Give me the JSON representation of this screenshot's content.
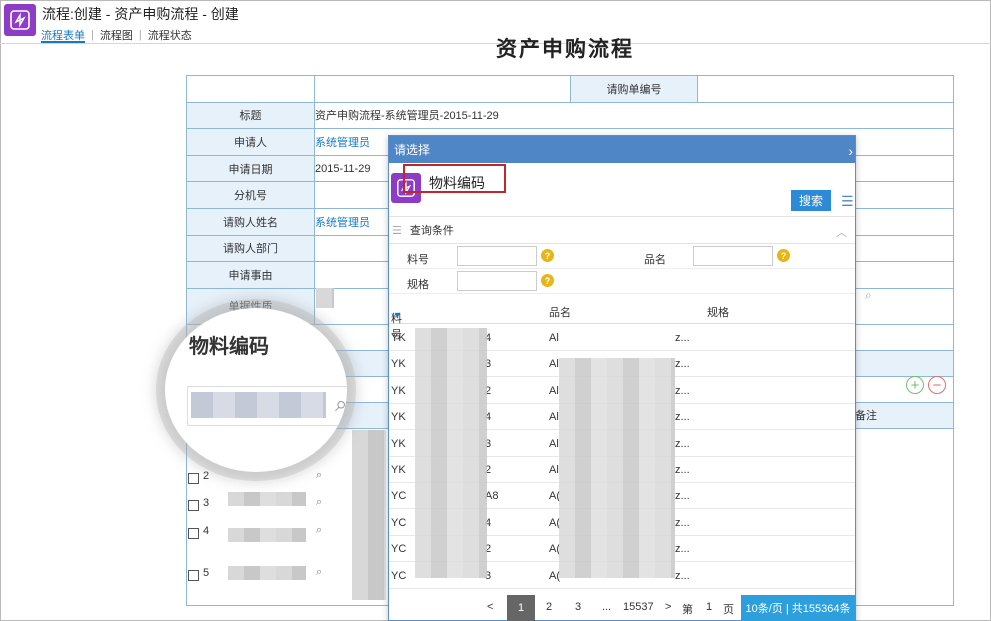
{
  "header": {
    "title": "流程:创建 - 资产申购流程 - 创建",
    "tabs": [
      {
        "label": "流程表单",
        "active": true
      },
      {
        "label": "流程图",
        "active": false
      },
      {
        "label": "流程状态",
        "active": false
      }
    ],
    "page_title": "资产申购流程"
  },
  "form": {
    "req_no_label": "请购单编号",
    "rows": [
      {
        "label": "标题",
        "value": "资产申购流程-系统管理员-2015-11-29"
      },
      {
        "label": "申请人",
        "value": "系统管理员"
      },
      {
        "label": "申请日期",
        "value": "2015-11-29"
      },
      {
        "label": "分机号",
        "value": ""
      },
      {
        "label": "请购人姓名",
        "value": "系统管理员"
      },
      {
        "label": "请购人部门",
        "value": ""
      },
      {
        "label": "申请事由",
        "value": ""
      },
      {
        "label": "单据性质",
        "value": ""
      }
    ],
    "remark_label": "备注",
    "detail_rows": [
      {
        "num": "2"
      },
      {
        "num": "3"
      },
      {
        "num": "4"
      },
      {
        "num": "5"
      }
    ]
  },
  "modal": {
    "title": "请选择",
    "subtitle": "物料编码",
    "search_label": "搜索",
    "conditions_label": "查询条件",
    "fields": [
      {
        "label": "料号",
        "value": ""
      },
      {
        "label": "品名",
        "value": ""
      },
      {
        "label": "规格",
        "value": ""
      }
    ],
    "columns": [
      "料号",
      "品名",
      "规格"
    ],
    "rows": [
      {
        "code_start": "YK",
        "code_end": "4",
        "name_start": "Al",
        "name_end": "z..."
      },
      {
        "code_start": "YK",
        "code_end": "3",
        "name_start": "Al",
        "name_end": "z..."
      },
      {
        "code_start": "YK",
        "code_end": "2",
        "name_start": "Al",
        "name_end": "z..."
      },
      {
        "code_start": "YK",
        "code_end": "4",
        "name_start": "Al",
        "name_end": "z..."
      },
      {
        "code_start": "YK",
        "code_end": "3",
        "name_start": "Al",
        "name_end": "z..."
      },
      {
        "code_start": "YK",
        "code_end": "2",
        "name_start": "Al",
        "name_end": "z..."
      },
      {
        "code_start": "YC",
        "code_end": "A8",
        "name_start": "A(",
        "name_end": "z..."
      },
      {
        "code_start": "YC",
        "code_end": "4",
        "name_start": "A(",
        "name_end": "z..."
      },
      {
        "code_start": "YC",
        "code_end": "2",
        "name_start": "A(",
        "name_end": "z..."
      },
      {
        "code_start": "YC",
        "code_end": "3",
        "name_start": "A(",
        "name_end": "z..."
      }
    ],
    "pager": {
      "prev": "<",
      "pages": [
        "1",
        "2",
        "3",
        "...",
        "15537"
      ],
      "next": ">",
      "goto_prefix": "第",
      "goto_value": "1",
      "goto_suffix": "页",
      "summary": "10条/页 | 共155364条"
    }
  },
  "magnifier": {
    "text": "物料编码"
  }
}
